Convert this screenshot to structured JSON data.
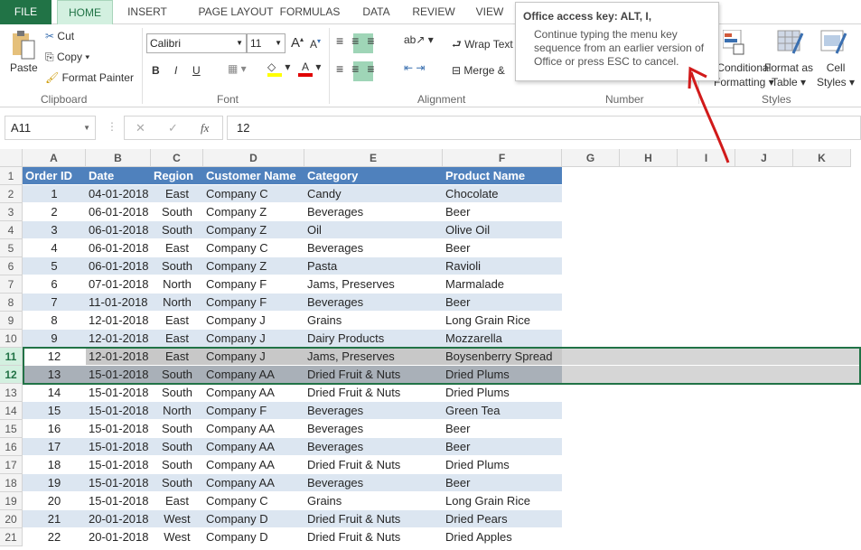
{
  "tabs": [
    "FILE",
    "HOME",
    "INSERT",
    "PAGE LAYOUT",
    "FORMULAS",
    "DATA",
    "REVIEW",
    "VIEW"
  ],
  "clipboard": {
    "paste": "Paste",
    "cut": "Cut",
    "copy": "Copy",
    "format_painter": "Format Painter",
    "label": "Clipboard"
  },
  "font": {
    "name": "Calibri",
    "size": "11",
    "bold": "B",
    "italic": "I",
    "underline": "U",
    "label": "Font",
    "fill_color": "#ffff00",
    "font_color": "#e00000"
  },
  "alignment": {
    "wrap": "Wrap Text",
    "merge": "Merge &",
    "label": "Alignment"
  },
  "number": {
    "label": "Number"
  },
  "styles": {
    "conditional": "Conditional",
    "conditional2": "Formatting",
    "format_table": "Format as",
    "format_table2": "Table",
    "cell_styles": "Cell",
    "cell_styles2": "Styles",
    "label": "Styles"
  },
  "tooltip": {
    "title": "Office access key: ALT, I,",
    "body": "Continue typing the menu key sequence from an earlier version of Office or press ESC to cancel."
  },
  "formula_bar": {
    "name_box": "A11",
    "value": "12",
    "fx": "fx"
  },
  "columns": [
    "A",
    "B",
    "C",
    "D",
    "E",
    "F",
    "G",
    "H",
    "I",
    "J",
    "K"
  ],
  "header": [
    "Order ID",
    "Date",
    "Region",
    "Customer Name",
    "Category",
    "Product Name"
  ],
  "rows": [
    [
      "1",
      "04-01-2018",
      "East",
      "Company C",
      "Candy",
      "Chocolate"
    ],
    [
      "2",
      "06-01-2018",
      "South",
      "Company Z",
      "Beverages",
      "Beer"
    ],
    [
      "3",
      "06-01-2018",
      "South",
      "Company Z",
      "Oil",
      "Olive Oil"
    ],
    [
      "4",
      "06-01-2018",
      "East",
      "Company C",
      "Beverages",
      "Beer"
    ],
    [
      "5",
      "06-01-2018",
      "South",
      "Company Z",
      "Pasta",
      "Ravioli"
    ],
    [
      "6",
      "07-01-2018",
      "North",
      "Company F",
      "Jams, Preserves",
      "Marmalade"
    ],
    [
      "7",
      "11-01-2018",
      "North",
      "Company F",
      "Beverages",
      "Beer"
    ],
    [
      "8",
      "12-01-2018",
      "East",
      "Company J",
      "Grains",
      "Long Grain Rice"
    ],
    [
      "9",
      "12-01-2018",
      "East",
      "Company J",
      "Dairy Products",
      "Mozzarella"
    ],
    [
      "12",
      "12-01-2018",
      "East",
      "Company J",
      "Jams, Preserves",
      "Boysenberry Spread"
    ],
    [
      "13",
      "15-01-2018",
      "South",
      "Company AA",
      "Dried Fruit & Nuts",
      "Dried Plums"
    ],
    [
      "14",
      "15-01-2018",
      "South",
      "Company AA",
      "Dried Fruit & Nuts",
      "Dried Plums"
    ],
    [
      "15",
      "15-01-2018",
      "North",
      "Company F",
      "Beverages",
      "Green Tea"
    ],
    [
      "16",
      "15-01-2018",
      "South",
      "Company AA",
      "Beverages",
      "Beer"
    ],
    [
      "17",
      "15-01-2018",
      "South",
      "Company AA",
      "Beverages",
      "Beer"
    ],
    [
      "18",
      "15-01-2018",
      "South",
      "Company AA",
      "Dried Fruit & Nuts",
      "Dried Plums"
    ],
    [
      "19",
      "15-01-2018",
      "South",
      "Company AA",
      "Beverages",
      "Beer"
    ],
    [
      "20",
      "15-01-2018",
      "East",
      "Company C",
      "Grains",
      "Long Grain Rice"
    ],
    [
      "21",
      "20-01-2018",
      "West",
      "Company D",
      "Dried Fruit & Nuts",
      "Dried Pears"
    ],
    [
      "22",
      "20-01-2018",
      "West",
      "Company D",
      "Dried Fruit & Nuts",
      "Dried Apples"
    ]
  ],
  "colors": {
    "header_bg": "#4f81bd",
    "band": "#dce6f1",
    "selected": "#c8c8c8",
    "selected_dark": "#a9b0b8",
    "accent": "#217346",
    "annotation": "#d11a1a"
  }
}
